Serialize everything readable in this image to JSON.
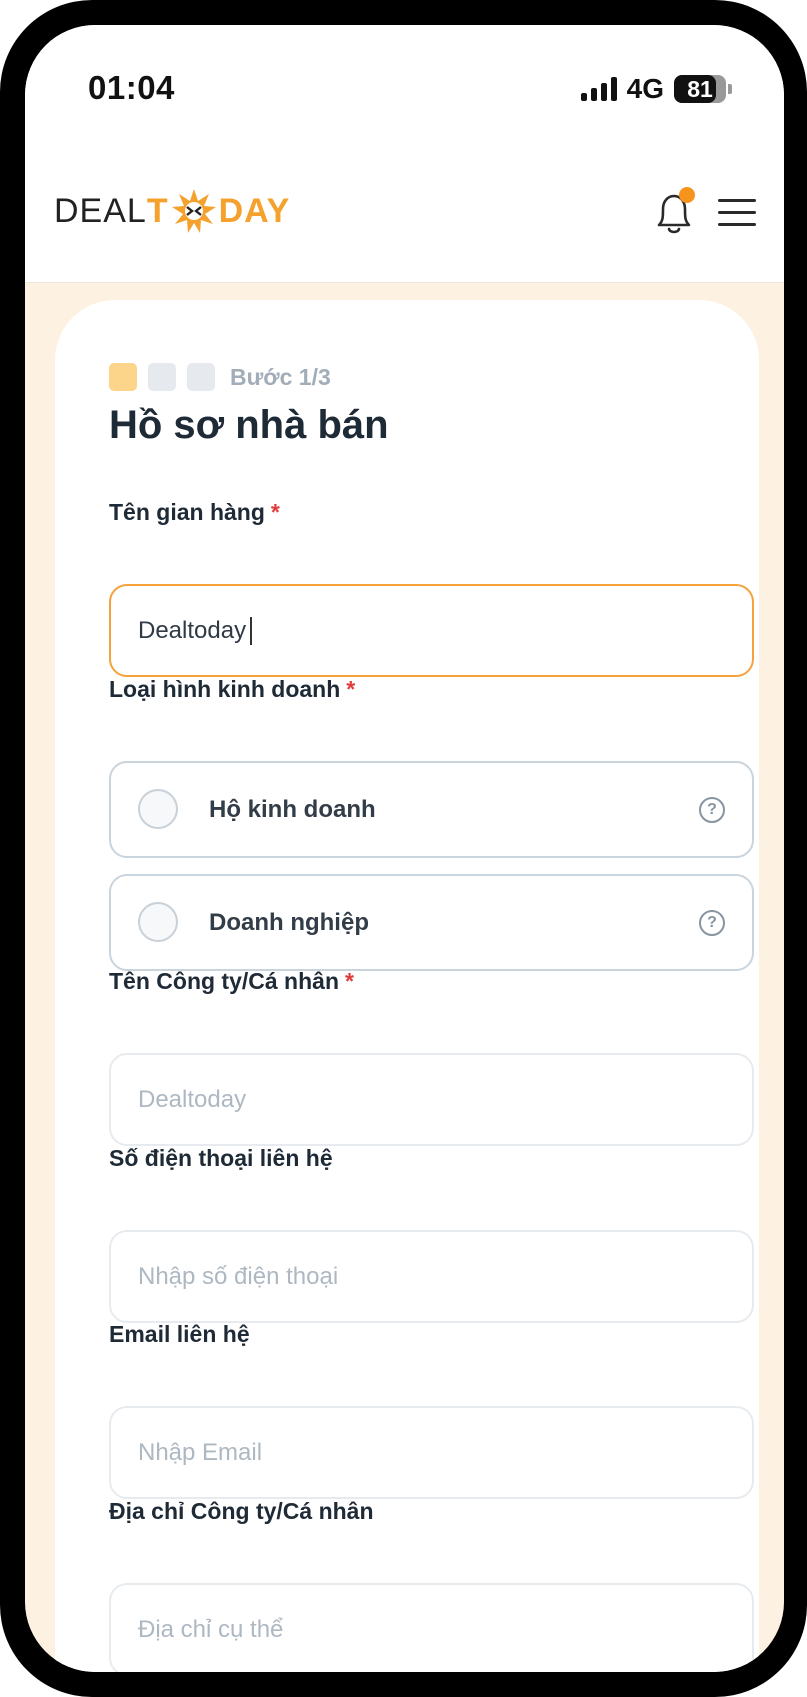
{
  "status_bar": {
    "time": "01:04",
    "network": "4G",
    "battery": "81",
    "battery_level": 0.81
  },
  "header": {
    "logo_text_part1": "DEAL",
    "logo_text_t": "T",
    "logo_text_part2": "DAY",
    "has_notification": true,
    "icons": [
      "bell-icon",
      "hamburger-menu-icon"
    ]
  },
  "colors": {
    "accent": "#f4a22d",
    "page_bg": "#fdf1e2",
    "focused_border": "#f5a23b",
    "required": "#e23a3a"
  },
  "form": {
    "step_label": "Bước 1/3",
    "step_current": 1,
    "step_total": 3,
    "title": "Hồ sơ nhà bán",
    "shop_name": {
      "label": "Tên gian hàng",
      "required_mark": "*",
      "value": "Dealtoday"
    },
    "business_type": {
      "label": "Loại hình kinh doanh",
      "required_mark": "*",
      "options": [
        {
          "label": "Hộ kinh doanh",
          "selected": false
        },
        {
          "label": "Doanh nghiệp",
          "selected": false
        }
      ]
    },
    "company_name": {
      "label": "Tên Công ty/Cá nhân",
      "required_mark": "*",
      "placeholder": "Dealtoday"
    },
    "phone": {
      "label": "Số điện thoại liên hệ",
      "placeholder": "Nhập số điện thoại"
    },
    "email": {
      "label": "Email liên hệ",
      "placeholder": "Nhập Email"
    },
    "address": {
      "label": "Địa chỉ Công ty/Cá nhân",
      "placeholder": "Địa chỉ cụ thể"
    }
  }
}
